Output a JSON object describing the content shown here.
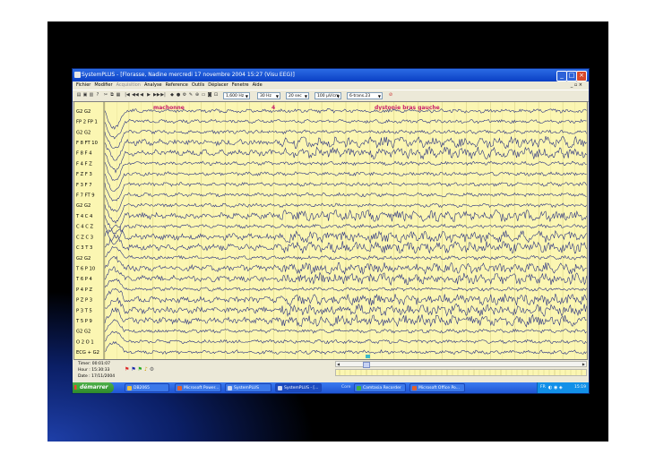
{
  "window": {
    "title": "SystemPLUS - [Florasse, Nadine mercredi 17 novembre 2004 15:27 (Visu EEG)]"
  },
  "menu": [
    {
      "label": "Fichier",
      "enabled": true
    },
    {
      "label": "Modifier",
      "enabled": true
    },
    {
      "label": "Acquisition",
      "enabled": false
    },
    {
      "label": "Analyse",
      "enabled": true
    },
    {
      "label": "Reference",
      "enabled": true
    },
    {
      "label": "Outils",
      "enabled": true
    },
    {
      "label": "Déplacer",
      "enabled": true
    },
    {
      "label": "Fenetre",
      "enabled": true
    },
    {
      "label": "Aide",
      "enabled": true
    }
  ],
  "toolbar": {
    "low_filter": "1,600 Hz",
    "high_filter": "30 Hz",
    "timebase": "20 sec",
    "gain": "100 µV/cm",
    "montage": "6-trans.23"
  },
  "annotations": [
    {
      "label": "machonne",
      "color": "#c8206a"
    },
    {
      "label": "4",
      "color": "#c8206a"
    },
    {
      "label": "dystonie bras gauche",
      "color": "#c8206a"
    }
  ],
  "channels": [
    "G2 G2",
    "FP 2 FP 1",
    "G2 G2",
    "F 8 FT 10",
    "F 8 F 4",
    "F 4 F Z",
    "F Z F 3",
    "F 3 F 7",
    "F 7 FT 9",
    "G2 G2",
    "T 4 C 4",
    "C 4 C Z",
    "C Z C 3",
    "C 3 T 3",
    "G2 G2",
    "T 6 P 10",
    "T 6 P 4",
    "P 4 P Z",
    "P Z P 3",
    "P 3 T 5",
    "T 5 P 9",
    "G2 G2",
    "O 2 O 1",
    "ECG + G2"
  ],
  "status": {
    "timer": "Timer: 00:01:07",
    "hour": "Hour  : 15:30:33",
    "date": "Date  : 17/11/2004"
  },
  "taskbar": {
    "start_label": "démarrer",
    "tasks": [
      {
        "label": "DB2065"
      },
      {
        "label": "Microsoft Power..."
      },
      {
        "label": "SystemPLUS"
      },
      {
        "label": "SystemPLUS - [..."
      },
      {
        "label": "Camtasia Recorder"
      },
      {
        "label": "Microsoft Office Po..."
      }
    ],
    "tray_lang": "FR",
    "clock": "15:19",
    "core_label": "Core"
  },
  "colors": {
    "trace": "#1a237e",
    "background": "#fbf6b2",
    "annotation": "#c8206a"
  }
}
